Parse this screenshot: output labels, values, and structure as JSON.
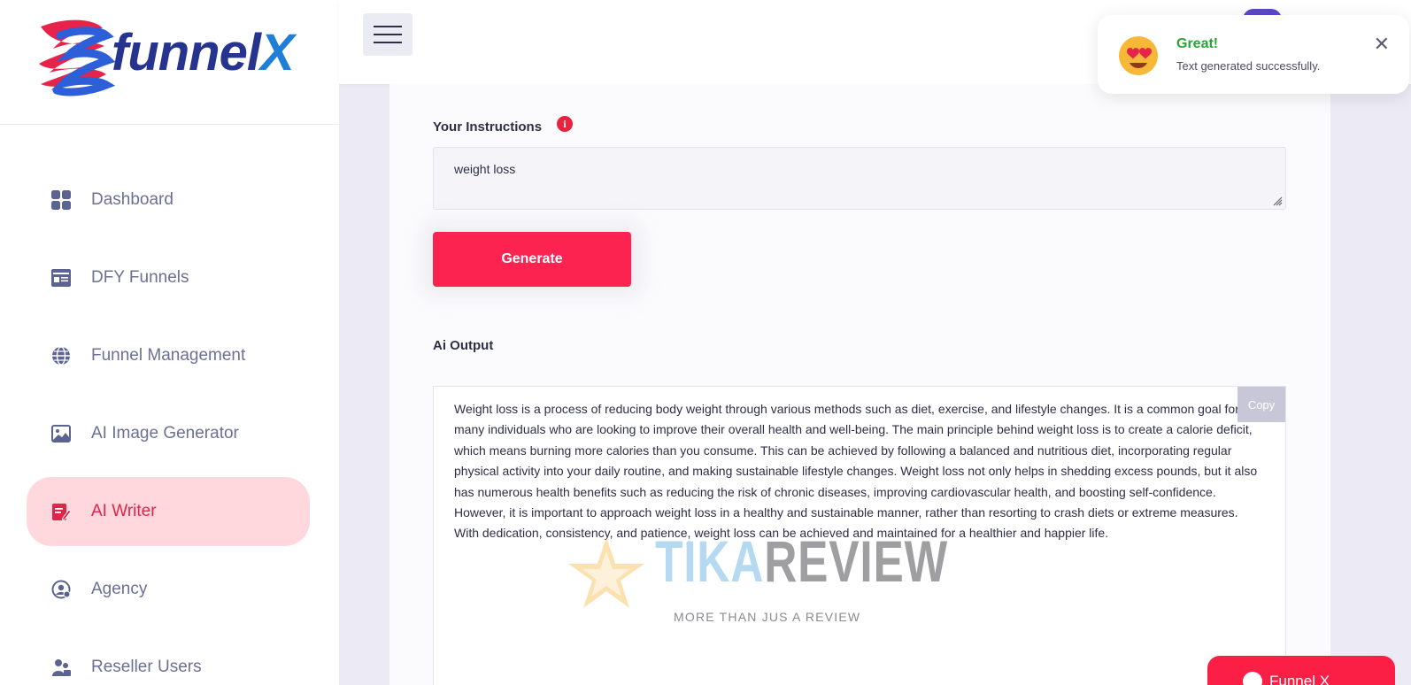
{
  "brand": {
    "name_part1": "funnel",
    "name_part2": "X"
  },
  "sidebar": {
    "items": [
      {
        "label": "Dashboard",
        "icon": "grid-icon"
      },
      {
        "label": "DFY Funnels",
        "icon": "id-card-icon"
      },
      {
        "label": "Funnel Management",
        "icon": "globe-icon"
      },
      {
        "label": "AI Image Generator",
        "icon": "image-icon"
      },
      {
        "label": "AI Writer",
        "icon": "edit-icon",
        "active": true
      },
      {
        "label": "Agency",
        "icon": "user-circle-icon"
      },
      {
        "label": "Reseller Users",
        "icon": "users-icon"
      }
    ]
  },
  "form": {
    "instructions_label": "Your Instructions",
    "instructions_value": "weight loss",
    "generate_label": "Generate",
    "output_label": "Ai Output",
    "copy_label": "Copy",
    "output_text": "Weight loss is a process of reducing body weight through various methods such as diet, exercise, and lifestyle changes. It is a common goal for many individuals who are looking to improve their overall health and well-being. The main principle behind weight loss is to create a calorie deficit, which means burning more calories than you consume. This can be achieved by following a balanced and nutritious diet, incorporating regular physical activity into your daily routine, and making sustainable lifestyle changes. Weight loss not only helps in shedding excess pounds, but it also has numerous health benefits such as reducing the risk of chronic diseases, improving cardiovascular health, and boosting self-confidence. However, it is important to approach weight loss in a healthy and sustainable manner, rather than resorting to crash diets or extreme measures. With dedication, consistency, and patience, weight loss can be achieved and maintained for a healthier and happier life."
  },
  "toast": {
    "title": "Great!",
    "message": "Text generated successfully.",
    "close": "✕"
  },
  "watermark": {
    "brand_a": "TIKA",
    "brand_b": "REVIEW",
    "tagline": "MORE THAN JUS A REVIEW"
  },
  "chat": {
    "label": "Funnel X"
  },
  "colors": {
    "accent": "#fd2351",
    "active_bg": "#ffd8de",
    "nav_text": "#6b7094",
    "success": "#29a537"
  }
}
